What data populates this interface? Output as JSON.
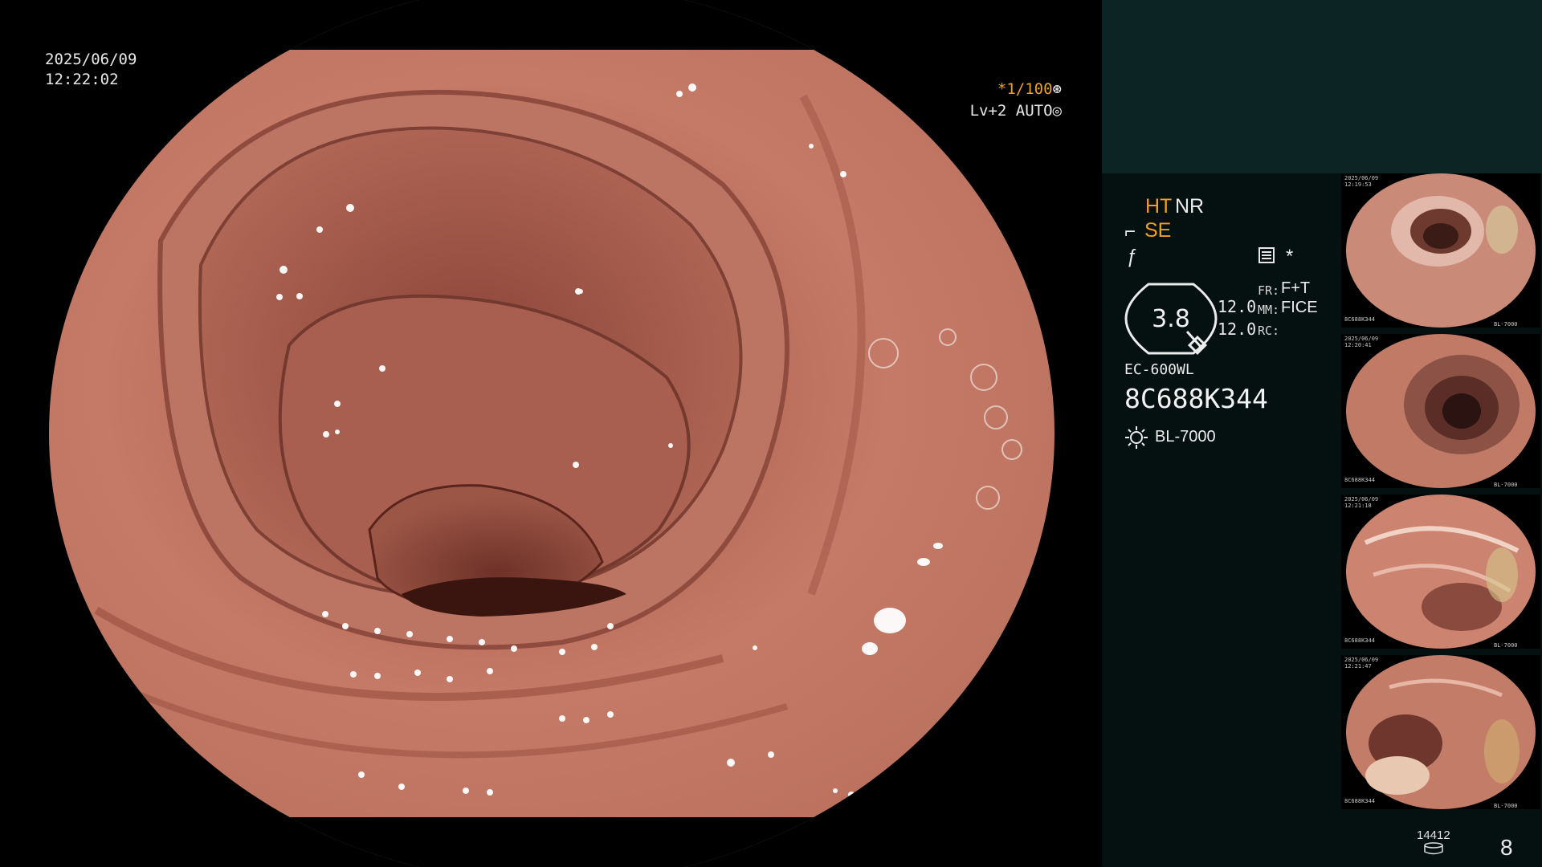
{
  "view": {
    "date": "2025/06/09",
    "time": "12:22:02",
    "shutter": "*1/100",
    "shutter_icon": "aperture-icon",
    "light_mode": "Lv+2 AUTO",
    "light_icon": "iris-icon"
  },
  "panel": {
    "ht": "HT",
    "nr": "NR",
    "se": "SE",
    "star": "*",
    "gauge_value": "3.8",
    "gauge_a": "12.0",
    "gauge_b": "12.0",
    "fr_label": "FR:",
    "fr_value": "F+T",
    "mm_label": "MM:",
    "mm_value": "FICE",
    "rc_label": "RC:",
    "scope_model": "EC-600WL",
    "scope_serial": "8C688K344",
    "light_source": "BL-7000",
    "image_count": "14412",
    "page_number": "8"
  },
  "thumbnails": [
    {
      "date": "2025/06/09",
      "time": "12:19:53",
      "serial": "8C688K344",
      "source": "BL-7000"
    },
    {
      "date": "2025/06/09",
      "time": "12:20:41",
      "serial": "8C688K344",
      "source": "BL-7000"
    },
    {
      "date": "2025/06/09",
      "time": "12:21:18",
      "serial": "8C688K344",
      "source": "BL-7000"
    },
    {
      "date": "2025/06/09",
      "time": "12:21:47",
      "serial": "8C688K344",
      "source": "BL-7000"
    }
  ],
  "colors": {
    "accent": "#f0a020",
    "tissue": "#b56a58",
    "panel_top": "#0c2424",
    "panel_body": "#051010"
  }
}
